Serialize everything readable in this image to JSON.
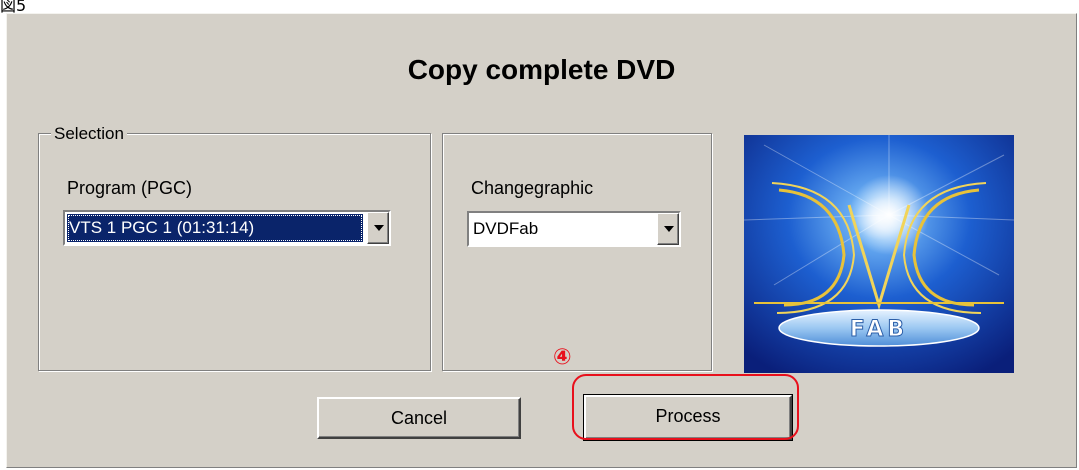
{
  "figure_label": "図5",
  "dialog": {
    "title": "Copy complete DVD",
    "selection_group": {
      "legend": "Selection",
      "program_label": "Program (PGC)",
      "program_value": "VTS 1 PGC 1 (01:31:14)"
    },
    "change_group": {
      "label": "Changegraphic",
      "value": "DVDFab"
    },
    "logo": {
      "text": "FAB"
    },
    "buttons": {
      "cancel": "Cancel",
      "process": "Process"
    }
  },
  "annotation": {
    "step_marker": "④",
    "color": "#e8101c"
  }
}
